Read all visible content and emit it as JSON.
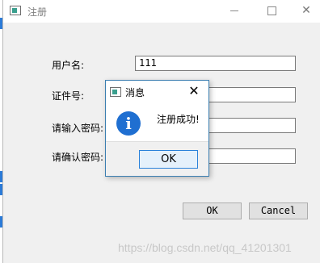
{
  "window": {
    "title": "注册",
    "minimize_icon": "minimize-icon",
    "maximize_icon": "maximize-icon",
    "close_glyph": "✕"
  },
  "form": {
    "username_label": "用户名:",
    "username_value": "111",
    "id_label": "证件号:",
    "id_value": "",
    "password_label": "请输入密码:",
    "password_value": "",
    "confirm_label": "请确认密码:",
    "confirm_value": "",
    "ok_label": "OK",
    "cancel_label": "Cancel"
  },
  "dialog": {
    "title": "消息",
    "close_glyph": "✕",
    "icon": "info-icon",
    "icon_glyph": "i",
    "message": "注册成功!",
    "ok_label": "OK"
  },
  "watermark": "https://blog.csdn.net/qq_41201301",
  "colors": {
    "accent": "#2a82da",
    "info": "#1f6fd1",
    "window_bg": "#f0f0f0"
  }
}
